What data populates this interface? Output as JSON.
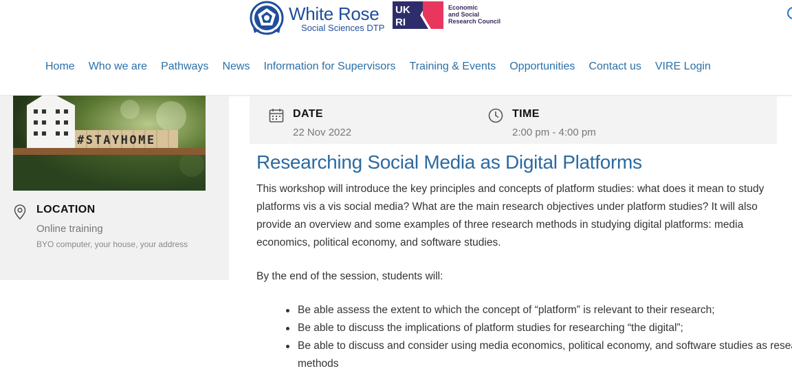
{
  "header": {
    "logo": {
      "title": "White Rose",
      "subtitle": "Social Sciences DTP"
    },
    "partner": {
      "ukri_letters": [
        "UK",
        "RI"
      ],
      "lines": [
        "Economic",
        "and Social",
        "Research Council"
      ]
    }
  },
  "nav": {
    "items": [
      {
        "label": "Home"
      },
      {
        "label": "Who we are"
      },
      {
        "label": "Pathways"
      },
      {
        "label": "News"
      },
      {
        "label": "Information for Supervisors"
      },
      {
        "label": "Training & Events"
      },
      {
        "label": "Opportunities"
      },
      {
        "label": "Contact us"
      },
      {
        "label": "VIRE Login"
      }
    ]
  },
  "sidebar": {
    "photo_text": "#STAYHOME",
    "location": {
      "label": "LOCATION",
      "value": "Online training",
      "detail": "BYO computer, your house, your address",
      "icon": "map-pin-icon"
    }
  },
  "event_meta": {
    "date": {
      "label": "DATE",
      "value": "22 Nov 2022",
      "icon": "calendar-icon"
    },
    "time": {
      "label": "TIME",
      "value": "2:00 pm - 4:00 pm",
      "icon": "clock-icon"
    }
  },
  "content": {
    "title": "Researching Social Media as Digital Platforms",
    "intro": "This workshop will introduce the key principles and concepts of platform studies: what does it mean to study platforms vis a vis social media? What are the main research objectives under platform studies? It will also provide an overview and some examples of three research methods in studying digital platforms: media economics, political economy, and software studies.",
    "outcomes_lead": "By the end of the session, students will:",
    "outcomes": [
      "Be able assess the extent to which the concept of “platform” is relevant to their research;",
      "Be able to discuss the implications of platform studies for researching “the digital”;",
      "Be able to discuss and consider using media economics, political economy, and software studies as research methods"
    ]
  },
  "colors": {
    "brand_blue": "#1f4e9a",
    "link_blue": "#2b70a8",
    "title_blue": "#2b6aa0",
    "ukri_navy": "#2e2d6b",
    "ukri_pink": "#e8365d"
  }
}
